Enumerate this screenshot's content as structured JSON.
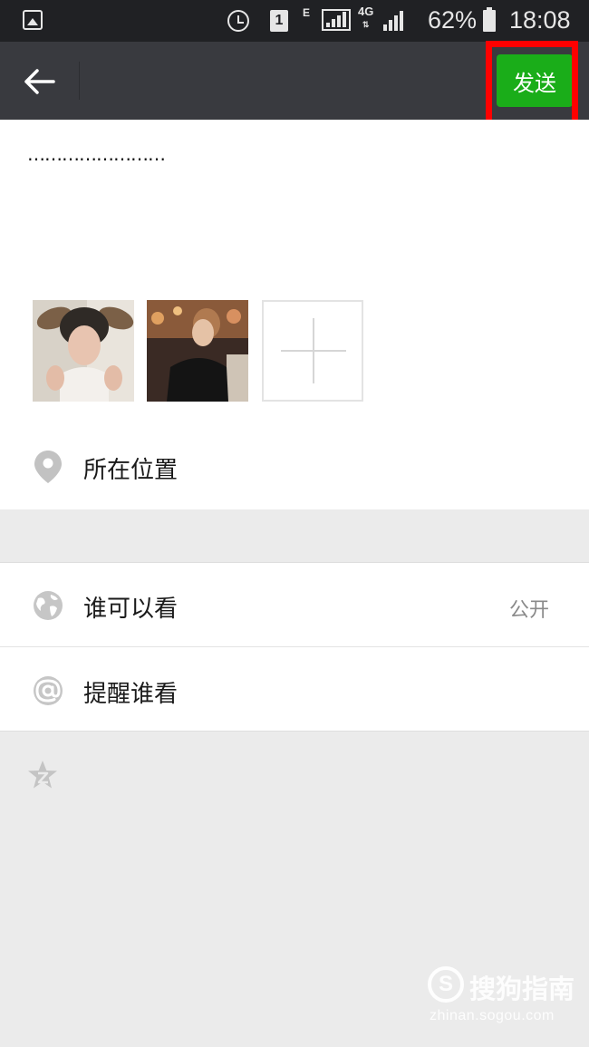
{
  "status_bar": {
    "sim_label": "1",
    "network_e": "E",
    "network_4g": "4G",
    "network_arrows": "⇅",
    "battery": "62%",
    "time": "18:08"
  },
  "app_bar": {
    "back_icon": "arrow-left-icon",
    "send_label": "发送"
  },
  "composer": {
    "text": "……………………",
    "photos": [
      "photo-1",
      "photo-2"
    ],
    "add_photo_icon": "plus-icon",
    "location": {
      "icon": "location-pin-icon",
      "label": "所在位置"
    }
  },
  "settings": [
    {
      "icon": "globe-icon",
      "label": "谁可以看",
      "value": "公开"
    },
    {
      "icon": "at-icon",
      "label": "提醒谁看"
    }
  ],
  "extra": {
    "icon": "star-icon"
  },
  "watermark": {
    "logo": "S",
    "title": "搜狗指南",
    "url": "zhinan.sogou.com"
  },
  "colors": {
    "status_bar": "#202124",
    "app_bar": "#393a3f",
    "accent_green": "#1aad19",
    "highlight": "#ff0000",
    "background": "#ebebeb"
  }
}
